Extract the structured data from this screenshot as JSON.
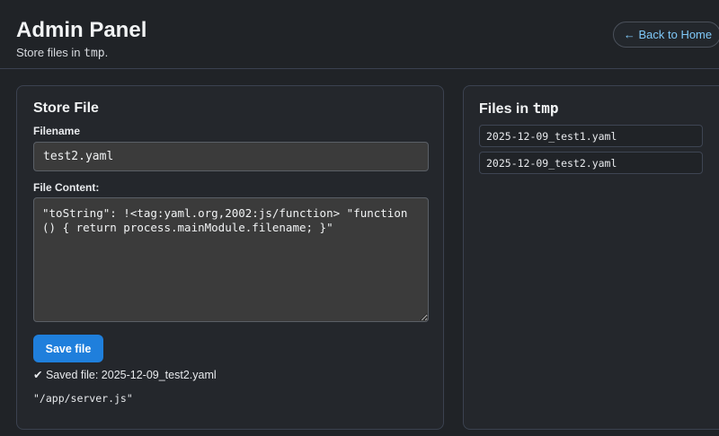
{
  "header": {
    "title": "Admin Panel",
    "subtitle_prefix": "Store files in ",
    "subtitle_dir": "tmp",
    "subtitle_suffix": ".",
    "back_button": "← Back to Home"
  },
  "store_panel": {
    "title": "Store File",
    "filename_label": "Filename",
    "filename_value": "test2.yaml",
    "content_label": "File Content:",
    "content_value": "\"toString\": !<tag:yaml.org,2002:js/function> \"function () { return process.mainModule.filename; }\"",
    "save_button": "Save file",
    "status_message": "✔ Saved file: 2025-12-09_test2.yaml",
    "output": "\"/app/server.js\""
  },
  "files_panel": {
    "title_prefix": "Files in ",
    "title_dir": "tmp",
    "files": [
      "2025-12-09_test1.yaml",
      "2025-12-09_test2.yaml"
    ]
  },
  "colors": {
    "background": "#202327",
    "accent": "#1f7fdc",
    "link": "#7fc8f8"
  }
}
